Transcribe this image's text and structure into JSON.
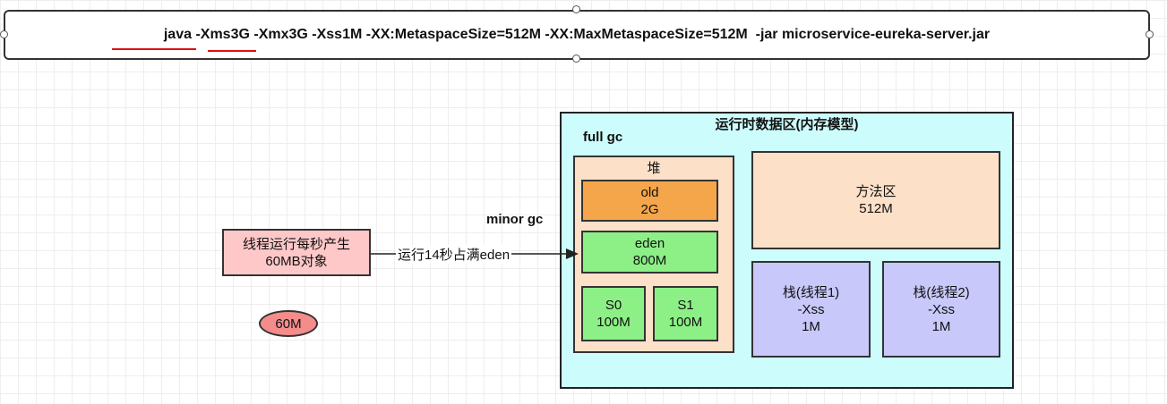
{
  "command": "java -Xms3G -Xmx3G -Xss1M -XX:MetaspaceSize=512M -XX:MaxMetaspaceSize=512M  -jar microservice-eureka-server.jar",
  "runtime_area": {
    "title": "运行时数据区(内存模型)",
    "full_gc_label": "full gc"
  },
  "minor_gc_label": "minor gc",
  "heap": {
    "title": "堆",
    "old": {
      "name": "old",
      "size": "2G"
    },
    "eden": {
      "name": "eden",
      "size": "800M"
    },
    "s0": {
      "name": "S0",
      "size": "100M"
    },
    "s1": {
      "name": "S1",
      "size": "100M"
    }
  },
  "method_area": {
    "name": "方法区",
    "size": "512M"
  },
  "stacks": [
    {
      "name": "栈(线程1)",
      "param": "-Xss",
      "size": "1M"
    },
    {
      "name": "栈(线程2)",
      "param": "-Xss",
      "size": "1M"
    }
  ],
  "thread_box": {
    "line1": "线程运行每秒产生",
    "line2": "60MB对象"
  },
  "arrow_label": "运行14秒占满eden",
  "ellipse_label": "60M",
  "colors": {
    "runtime_bg": "#ccfcfc",
    "heap_bg": "#fde0c8",
    "old_bg": "#f5a54a",
    "young_bg": "#8cf086",
    "stack_bg": "#c8c8fa",
    "thread_bg": "#ffc8c8",
    "ellipse_bg": "#f58c8c",
    "underline": "#e01010"
  }
}
